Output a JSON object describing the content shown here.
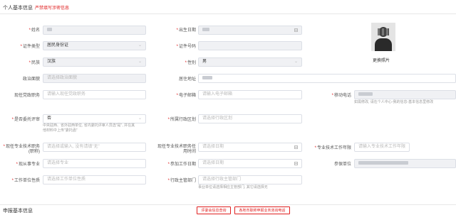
{
  "header": {
    "title": "个人基本信息",
    "warning": "严禁填写涉密信息"
  },
  "labels": {
    "name": "姓名",
    "birth": "出生日期",
    "id_type": "证件类型",
    "id_no": "证件号码",
    "ethnic": "民族",
    "gender": "性别",
    "political": "政治面貌",
    "address": "居住地址",
    "cur_post": "现任党政职务",
    "email": "电子邮箱",
    "mobile": "移动电话",
    "recommend": "是否委托评审",
    "region": "所属行政区划",
    "cur_title_1": "现任专业技术职务",
    "cur_title_2": "(职称)",
    "cur_title_date_1": "现任专业技术职务任",
    "cur_title_date_2": "用时间",
    "tech_work_years": "专业技术工作年限",
    "major": "现从事专业",
    "work_date": "参加工作日期",
    "unit": "参保单位",
    "unit_type": "工作单位性质",
    "admin_dept": "行政主管部门"
  },
  "values": {
    "id_type": "居民身份证",
    "ethnic": "汉族",
    "gender": "男",
    "recommend": "否"
  },
  "placeholders": {
    "political": "请选择政治面貌",
    "cur_post": "请输入现任党政职务",
    "email": "请输入电子邮箱",
    "region": "请选择行政区划",
    "cur_title": "请选择或输入, 没有请填\"无\"",
    "cur_title_date": "请选择日期",
    "tech_work_years": "请输入专业技术工作年限",
    "major": "请选择专业",
    "work_date": "请选择日期",
    "unit_type": "请选择工作单位性质",
    "admin_dept": "请选择行政主管部门"
  },
  "hints": {
    "mobile": "如需修改, 请在个人中心-我的信息-基本信息里修改",
    "recommend_1": "中央驻西、省外驻西单位, 省内委托评审人员选\"是\", 并在其",
    "recommend_2": "他材料中上传\"委托函\"",
    "admin_dept": "事业单位请选择相应主管部门, 其它请选择无"
  },
  "photo": {
    "button": "更换照片"
  },
  "section2": {
    "title": "申报基本信息"
  },
  "buttons": {
    "query_certificate": "评委会信息查询",
    "query_review": "各地市职称申报业务咨询电话"
  },
  "colors": {
    "required": "#e02020",
    "border": "#dcdfe6",
    "disabled_bg": "#f0f1f4"
  }
}
